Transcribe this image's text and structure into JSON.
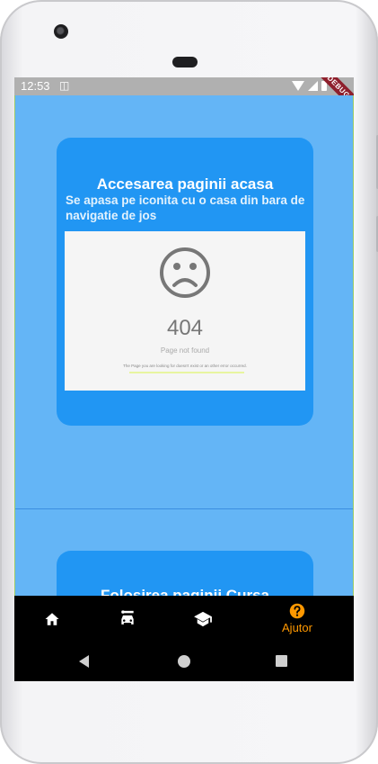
{
  "status_bar": {
    "time": "12:53",
    "debug_label": "DEBUG"
  },
  "cards": [
    {
      "title": "Accesarea paginii acasa",
      "description": "Se apasa pe iconita cu o casa din bara de navigatie de jos",
      "image": {
        "icon": "sad-face-icon",
        "code": "404",
        "message": "Page not found",
        "detail": "The Page you are looking for doesn't exist or an other error occurred."
      }
    },
    {
      "title": "Folosirea paginii Cursa"
    }
  ],
  "bottom_nav": {
    "items": [
      {
        "icon": "home-icon",
        "label": ""
      },
      {
        "icon": "car-route-icon",
        "label": ""
      },
      {
        "icon": "school-icon",
        "label": ""
      },
      {
        "icon": "help-icon",
        "label": "Ajutor",
        "active": true
      }
    ],
    "active_color": "#ff9800"
  },
  "colors": {
    "background": "#64b5f6",
    "card": "#2196f3",
    "nav_bar": "#000000",
    "status_bar": "#b0b0b0"
  }
}
